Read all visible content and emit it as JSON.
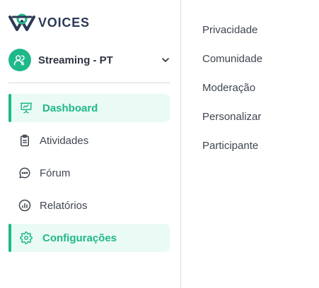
{
  "brand": {
    "name": "VOICES",
    "accent": "#1fb88a",
    "logo_color": "#2b3a55"
  },
  "workspace": {
    "name": "Streaming - PT",
    "avatar_icon": "users-icon",
    "chevron_icon": "chevron-down-icon"
  },
  "sidebar": {
    "items": [
      {
        "label": "Dashboard",
        "icon": "presentation-icon",
        "active": true
      },
      {
        "label": "Atividades",
        "icon": "clipboard-icon",
        "active": false
      },
      {
        "label": "Fórum",
        "icon": "chat-bubble-icon",
        "active": false
      },
      {
        "label": "Relatórios",
        "icon": "bar-chart-icon",
        "active": false
      },
      {
        "label": "Configurações",
        "icon": "gear-icon",
        "active": true
      }
    ]
  },
  "settings_menu": {
    "items": [
      "Privacidade",
      "Comunidade",
      "Moderação",
      "Personalizar",
      "Participante"
    ]
  }
}
